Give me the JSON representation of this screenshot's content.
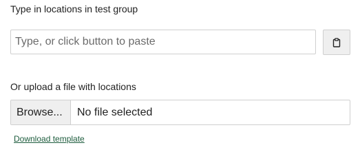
{
  "locations_section": {
    "label": "Type in locations in test group",
    "input_placeholder": "Type, or click button to paste",
    "input_value": "",
    "paste_button_icon": "clipboard-icon"
  },
  "upload_section": {
    "label": "Or upload a file with locations",
    "browse_label": "Browse...",
    "file_status": "No file selected"
  },
  "download_template_link": "Download template",
  "colors": {
    "link": "#1d5c3d",
    "border": "#cfcfcf",
    "button_bg": "#efefef"
  }
}
